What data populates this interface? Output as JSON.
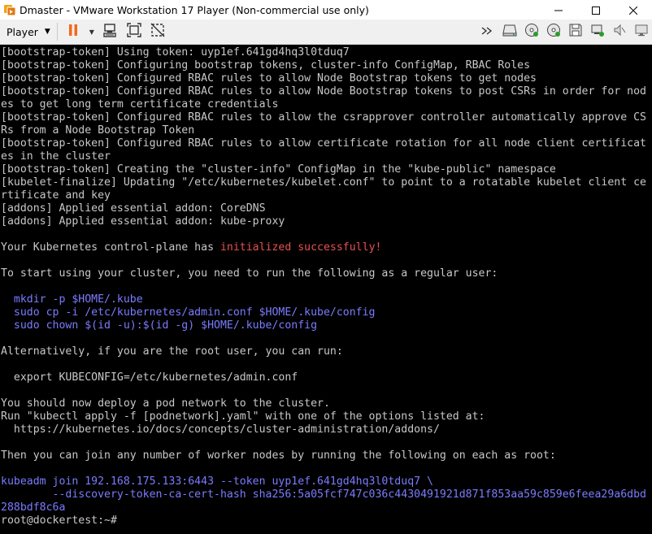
{
  "window": {
    "title": "Dmaster - VMware Workstation 17 Player (Non-commercial use only)"
  },
  "toolbar": {
    "player_label": "Player"
  },
  "terminal": {
    "lines": [
      "[bootstrap-token] Using token: uyp1ef.641gd4hq3l0tduq7",
      "[bootstrap-token] Configuring bootstrap tokens, cluster-info ConfigMap, RBAC Roles",
      "[bootstrap-token] Configured RBAC rules to allow Node Bootstrap tokens to get nodes",
      "[bootstrap-token] Configured RBAC rules to allow Node Bootstrap tokens to post CSRs in order for nod",
      "es to get long term certificate credentials",
      "[bootstrap-token] Configured RBAC rules to allow the csrapprover controller automatically approve CS",
      "Rs from a Node Bootstrap Token",
      "[bootstrap-token] Configured RBAC rules to allow certificate rotation for all node client certificat",
      "es in the cluster",
      "[bootstrap-token] Creating the \"cluster-info\" ConfigMap in the \"kube-public\" namespace",
      "[kubelet-finalize] Updating \"/etc/kubernetes/kubelet.conf\" to point to a rotatable kubelet client ce",
      "rtificate and key",
      "[addons] Applied essential addon: CoreDNS",
      "[addons] Applied essential addon: kube-proxy"
    ],
    "success_prefix": "Your Kubernetes control-plane has ",
    "success_highlight": "initialized successfully!",
    "start_using": "To start using your cluster, you need to run the following as a regular user:",
    "user_commands": [
      "  mkdir -p $HOME/.kube",
      "  sudo cp -i /etc/kubernetes/admin.conf $HOME/.kube/config",
      "  sudo chown $(id -u):$(id -g) $HOME/.kube/config"
    ],
    "root_intro": "Alternatively, if you are the root user, you can run:",
    "export_command": "  export KUBECONFIG=/etc/kubernetes/admin.conf",
    "network_lines": [
      "You should now deploy a pod network to the cluster.",
      "Run \"kubectl apply -f [podnetwork].yaml\" with one of the options listed at:",
      "  https://kubernetes.io/docs/concepts/cluster-administration/addons/"
    ],
    "join_intro": "Then you can join any number of worker nodes by running the following on each as root:",
    "join_commands": [
      "kubeadm join 192.168.175.133:6443 --token uyp1ef.641gd4hq3l0tduq7 \\",
      "        --discovery-token-ca-cert-hash sha256:5a05fcf747c036c4430491921d871f853aa59c859e6feea29a6dbd",
      "288bdf8c6a"
    ],
    "prompt": "root@dockertest:~# "
  },
  "colors": {
    "terminal_bg": "#000000",
    "terminal_fg": "#c8c8c8",
    "command_blue": "#7b7bff",
    "success_red": "#e85050",
    "pause_orange": "#f06a1d"
  },
  "icons": {
    "app": "vmware-player-icon",
    "minimize": "minimize-icon",
    "maximize": "maximize-icon",
    "close": "close-icon",
    "pause": "pause-icon",
    "send_ctrl_alt_del": "send-ctrl-alt-del-icon",
    "fit_guest": "fit-guest-icon",
    "unity": "unity-icon",
    "forward": "double-chevron-icon",
    "hdd": "hard-disk-icon",
    "cd1": "cd-dvd-icon",
    "cd2": "cd-dvd-icon",
    "floppy": "floppy-icon",
    "network": "network-adapter-icon",
    "sound": "sound-muted-icon",
    "display": "display-icon"
  }
}
